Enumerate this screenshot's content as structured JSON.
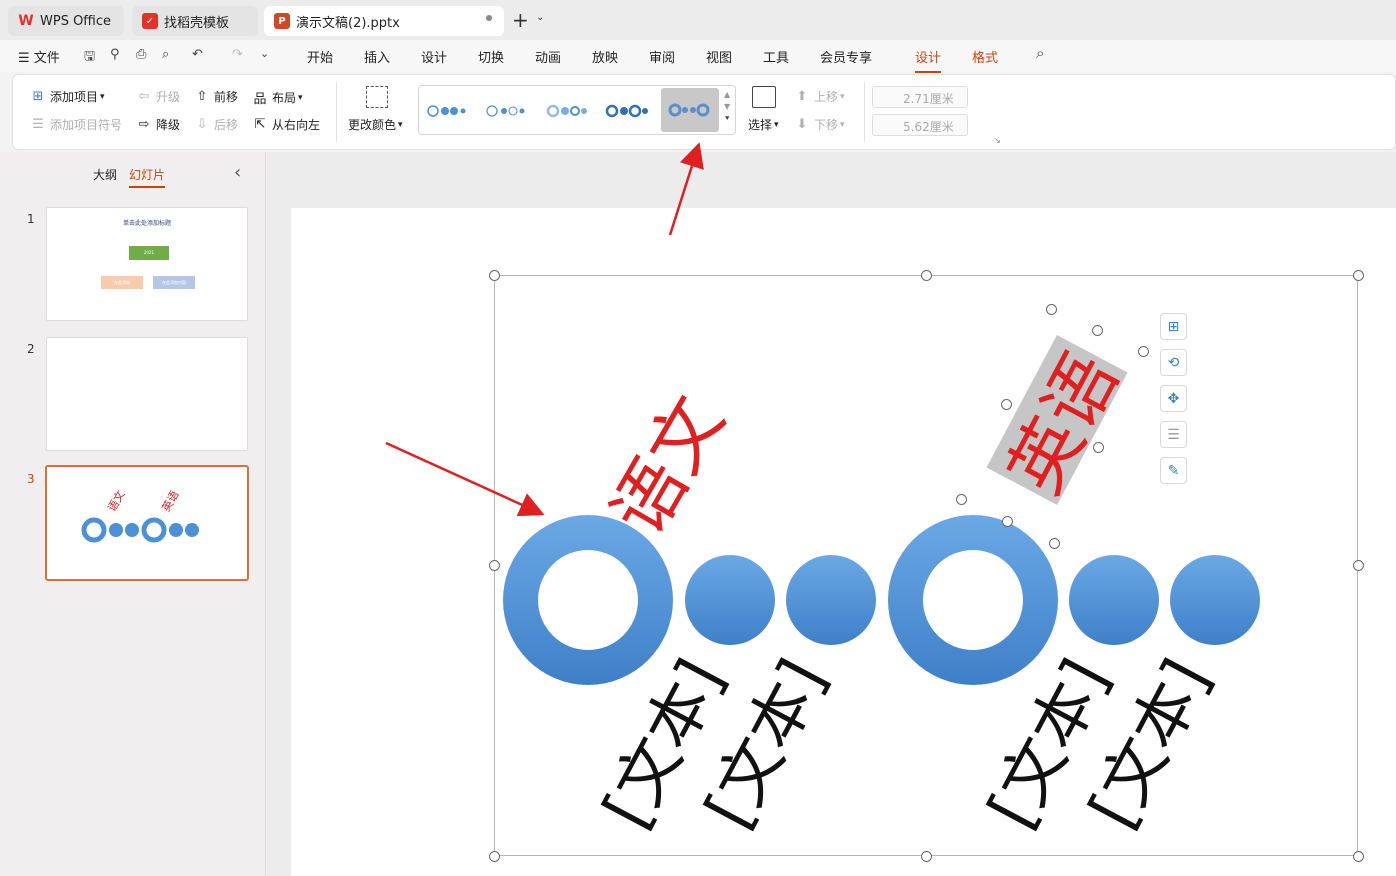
{
  "tabs": {
    "wps": "WPS Office",
    "template": "找稻壳模板",
    "doc": "演示文稿(2).pptx",
    "new_tab": "+"
  },
  "menubar": {
    "file": "文件",
    "items": [
      "开始",
      "插入",
      "设计",
      "切换",
      "动画",
      "放映",
      "审阅",
      "视图",
      "工具",
      "会员专享"
    ],
    "context_tabs": [
      "设计",
      "格式"
    ]
  },
  "ribbon": {
    "add_item": "添加项目",
    "add_bullet": "添加项目符号",
    "promote": "升级",
    "demote": "降级",
    "move_up": "前移",
    "move_down": "后移",
    "layout": "布局",
    "rtl": "从右向左",
    "change_color": "更改颜色",
    "select": "选择",
    "shift_up": "上移",
    "shift_down": "下移",
    "height": "2.71厘米",
    "width": "5.62厘米"
  },
  "leftpanel": {
    "tab_outline": "大纲",
    "tab_slides": "幻灯片",
    "collapse": "‹",
    "slides": [
      {
        "num": "1",
        "title": "单击此处添加标题",
        "top": "2021",
        "left": "在此添加",
        "right": "在此添加内容"
      },
      {
        "num": "2"
      },
      {
        "num": "3",
        "a": "语文",
        "b": "英语"
      }
    ]
  },
  "slide": {
    "label1": "语文",
    "label2": "英语",
    "text_placeholder": "[文本]"
  },
  "colors": {
    "accent": "#c8440e",
    "red_text": "#e02020",
    "circle_blue": "#4d90d6"
  }
}
